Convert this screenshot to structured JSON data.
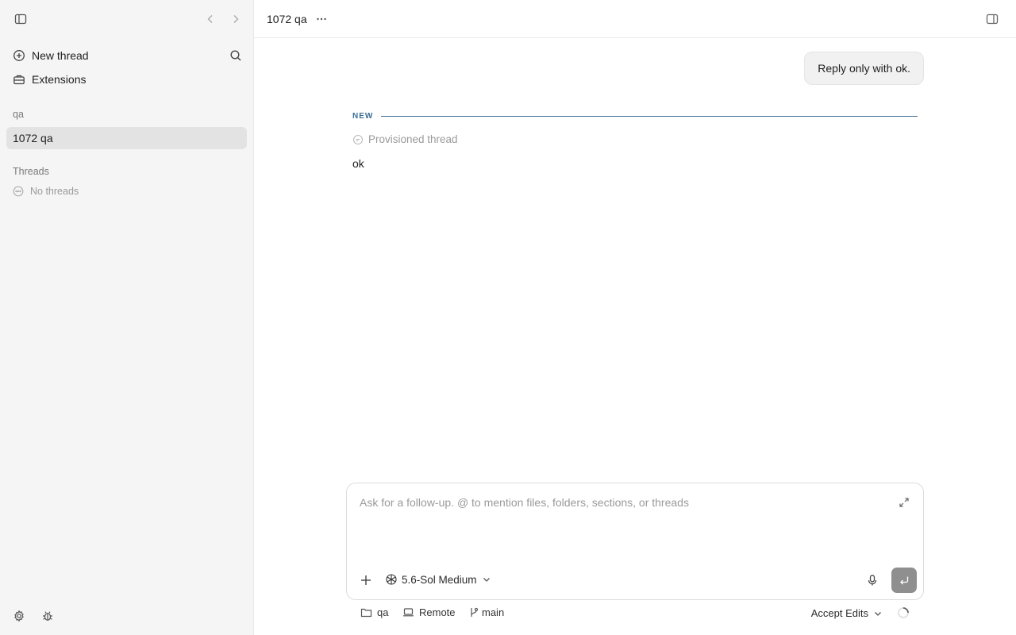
{
  "sidebar": {
    "new_thread_label": "New thread",
    "extensions_label": "Extensions",
    "project_section": "qa",
    "active_item": "1072 qa",
    "threads_section": "Threads",
    "no_threads_label": "No threads"
  },
  "header": {
    "title": "1072 qa"
  },
  "conversation": {
    "user_message": "Reply only with ok.",
    "new_label": "NEW",
    "status_label": "Provisioned thread",
    "assistant_reply": "ok"
  },
  "composer": {
    "placeholder": "Ask for a follow-up. @ to mention files, folders, sections, or threads",
    "model_label": "5.6-Sol Medium"
  },
  "footer": {
    "folder_label": "qa",
    "env_label": "Remote",
    "branch_label": "main",
    "mode_label": "Accept Edits"
  },
  "colors": {
    "accent": "#3d6e95",
    "sidebar_bg": "#f5f5f5",
    "active_item_bg": "#e3e3e3",
    "send_button": "#8f8f8f"
  },
  "icons": {
    "sidebar_toggle": "sidebar-toggle-icon",
    "back": "chevron-left-icon",
    "forward": "chevron-right-icon",
    "new_thread": "plus-circle-icon",
    "search": "search-icon",
    "extensions": "toolbox-icon",
    "settings": "gear-icon",
    "debug": "bug-icon",
    "more": "ellipsis-icon",
    "right_panel": "panel-right-icon",
    "expand": "expand-icon",
    "add": "plus-icon",
    "model": "openai-logo-icon",
    "mic": "microphone-icon",
    "send": "send-icon",
    "folder": "folder-icon",
    "laptop": "laptop-icon",
    "branch": "git-branch-icon",
    "loading": "spinner-icon"
  }
}
